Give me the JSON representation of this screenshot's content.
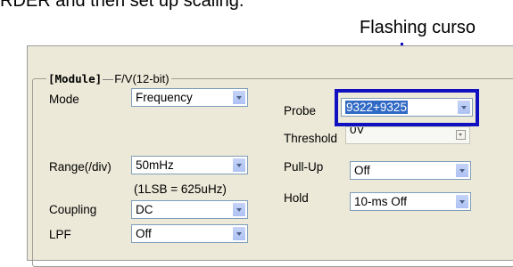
{
  "intro_text": "RDER and then set up scaling.",
  "callout_text": "Flashing curso",
  "group": {
    "module_label": "[Module]",
    "module_value": "F/V(12-bit)"
  },
  "fields": {
    "mode": {
      "label": "Mode",
      "value": "Frequency"
    },
    "range": {
      "label": "Range(/div)",
      "value": "50mHz",
      "note": "(1LSB = 625uHz)"
    },
    "coupling": {
      "label": "Coupling",
      "value": "DC"
    },
    "lpf": {
      "label": "LPF",
      "value": "Off"
    },
    "probe": {
      "label": "Probe",
      "value": "9322+9325"
    },
    "threshold": {
      "label": "Threshold",
      "value": "0V"
    },
    "pullup": {
      "label": "Pull-Up",
      "value": "Off"
    },
    "hold": {
      "label": "Hold",
      "value": "10-ms Off"
    }
  },
  "colors": {
    "highlight": "#1010c0",
    "panel": "#ece9d8",
    "selection": "#316ac5"
  }
}
